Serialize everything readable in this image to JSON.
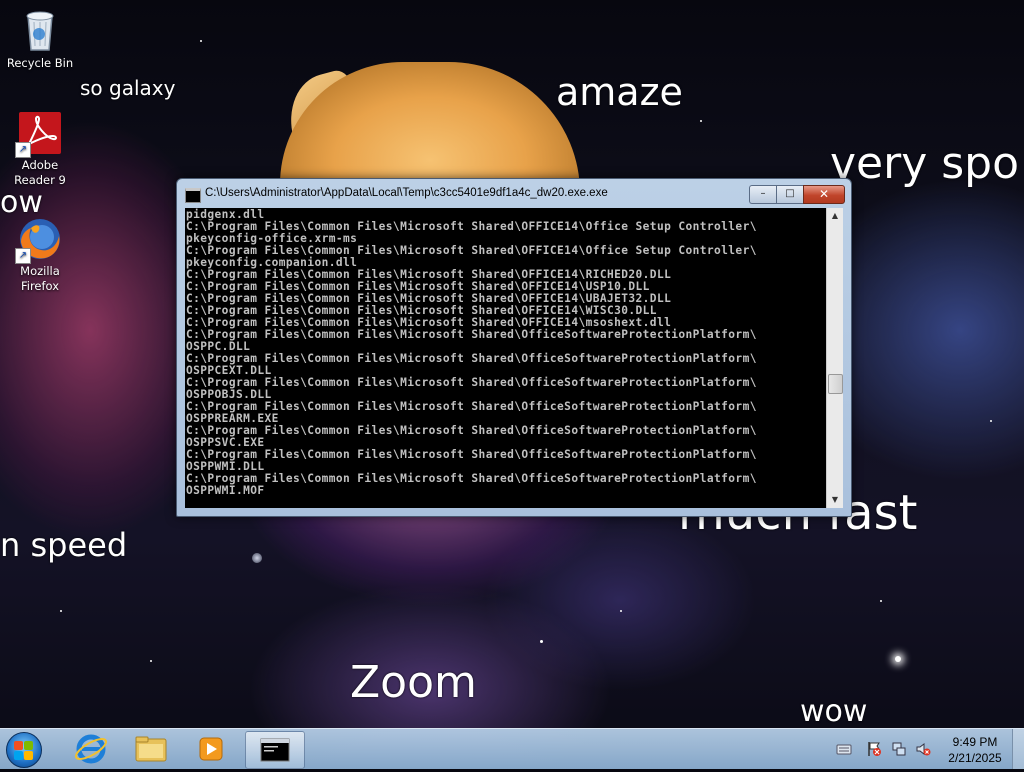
{
  "desktop": {
    "meme_texts": {
      "so_galaxy": "so galaxy",
      "amaze": "amaze",
      "very_spo": "very spo",
      "wow_left": "ow",
      "speed": "n speed",
      "much_fast": "much fast",
      "zoom": "Zoom",
      "wow_bottom": "wow"
    },
    "icons": [
      {
        "label": "Recycle Bin",
        "icon": "recycle-bin-icon"
      },
      {
        "label": "Adobe Reader 9",
        "icon": "adobe-reader-icon"
      },
      {
        "label": "Mozilla Firefox",
        "icon": "firefox-icon"
      }
    ]
  },
  "console_window": {
    "title": "C:\\Users\\Administrator\\AppData\\Local\\Temp\\c3cc5401e9df1a4c_dw20.exe.exe",
    "buttons": {
      "minimize": "–",
      "maximize": "□",
      "close": "✕"
    },
    "output": "pidgenx.dll\nC:\\Program Files\\Common Files\\Microsoft Shared\\OFFICE14\\Office Setup Controller\\\npkeyconfig-office.xrm-ms\nC:\\Program Files\\Common Files\\Microsoft Shared\\OFFICE14\\Office Setup Controller\\\npkeyconfig.companion.dll\nC:\\Program Files\\Common Files\\Microsoft Shared\\OFFICE14\\RICHED20.DLL\nC:\\Program Files\\Common Files\\Microsoft Shared\\OFFICE14\\USP10.DLL\nC:\\Program Files\\Common Files\\Microsoft Shared\\OFFICE14\\UBAJET32.DLL\nC:\\Program Files\\Common Files\\Microsoft Shared\\OFFICE14\\WISC30.DLL\nC:\\Program Files\\Common Files\\Microsoft Shared\\OFFICE14\\msoshext.dll\nC:\\Program Files\\Common Files\\Microsoft Shared\\OfficeSoftwareProtectionPlatform\\\nOSPPC.DLL\nC:\\Program Files\\Common Files\\Microsoft Shared\\OfficeSoftwareProtectionPlatform\\\nOSPPCEXT.DLL\nC:\\Program Files\\Common Files\\Microsoft Shared\\OfficeSoftwareProtectionPlatform\\\nOSPPOBJS.DLL\nC:\\Program Files\\Common Files\\Microsoft Shared\\OfficeSoftwareProtectionPlatform\\\nOSPPREARM.EXE\nC:\\Program Files\\Common Files\\Microsoft Shared\\OfficeSoftwareProtectionPlatform\\\nOSPPSVC.EXE\nC:\\Program Files\\Common Files\\Microsoft Shared\\OfficeSoftwareProtectionPlatform\\\nOSPPWMI.DLL\nC:\\Program Files\\Common Files\\Microsoft Shared\\OfficeSoftwareProtectionPlatform\\\nOSPPWMI.MOF",
    "scrollbar": {
      "up_arrow": "▲",
      "down_arrow": "▼"
    }
  },
  "taskbar": {
    "pinned": [
      {
        "name": "internet-explorer",
        "icon": "ie-icon"
      },
      {
        "name": "windows-explorer",
        "icon": "folder-icon"
      },
      {
        "name": "media-player",
        "icon": "media-player-icon"
      },
      {
        "name": "console",
        "icon": "console-icon",
        "active": true
      }
    ],
    "tray_icons": [
      "keyboard-icon",
      "action-center-flag-icon",
      "network-icon",
      "volume-muted-icon"
    ],
    "clock": {
      "time": "9:49 PM",
      "date": "2/21/2025"
    }
  },
  "colors": {
    "console_bg": "#000000",
    "console_text": "#c0c0c0",
    "close_button": "#c0452b",
    "taskbar": "#a9c4e0"
  }
}
